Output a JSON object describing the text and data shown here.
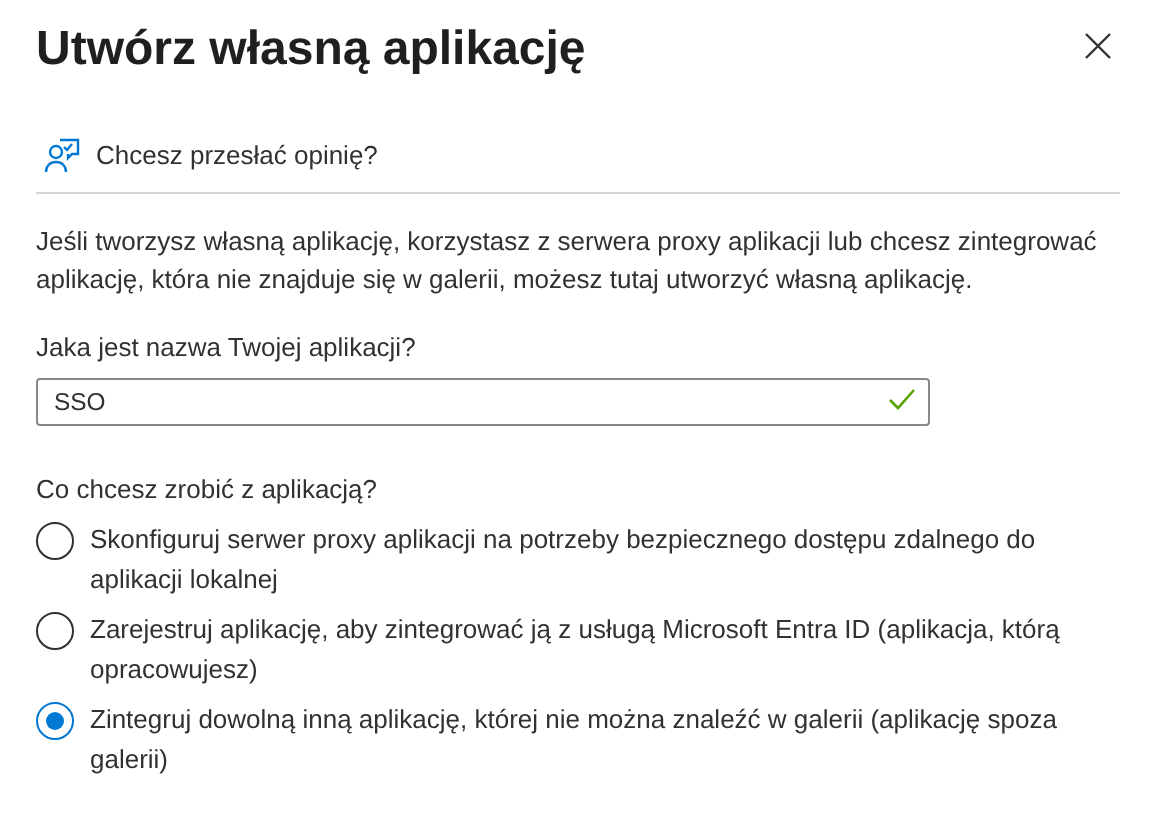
{
  "window": {
    "title": "Utwórz własną aplikację"
  },
  "feedback": {
    "label": "Chcesz przesłać opinię?"
  },
  "description": "Jeśli tworzysz własną aplikację, korzystasz z serwera proxy aplikacji lub chcesz zintegrować aplikację, która nie znajduje się w galerii, możesz tutaj utworzyć własną aplikację.",
  "name_field": {
    "label": "Jaka jest nazwa Twojej aplikacji?",
    "value": "SSO",
    "valid": true
  },
  "purpose": {
    "label": "Co chcesz zrobić z aplikacją?",
    "options": [
      {
        "label": "Skonfiguruj serwer proxy aplikacji na potrzeby bezpiecznego dostępu zdalnego do aplikacji lokalnej",
        "selected": false
      },
      {
        "label": "Zarejestruj aplikację, aby zintegrować ją z usługą Microsoft Entra ID (aplikacja, którą opracowujesz)",
        "selected": false
      },
      {
        "label": "Zintegruj dowolną inną aplikację, której nie można znaleźć w galerii (aplikację spoza galerii)",
        "selected": true
      }
    ]
  }
}
